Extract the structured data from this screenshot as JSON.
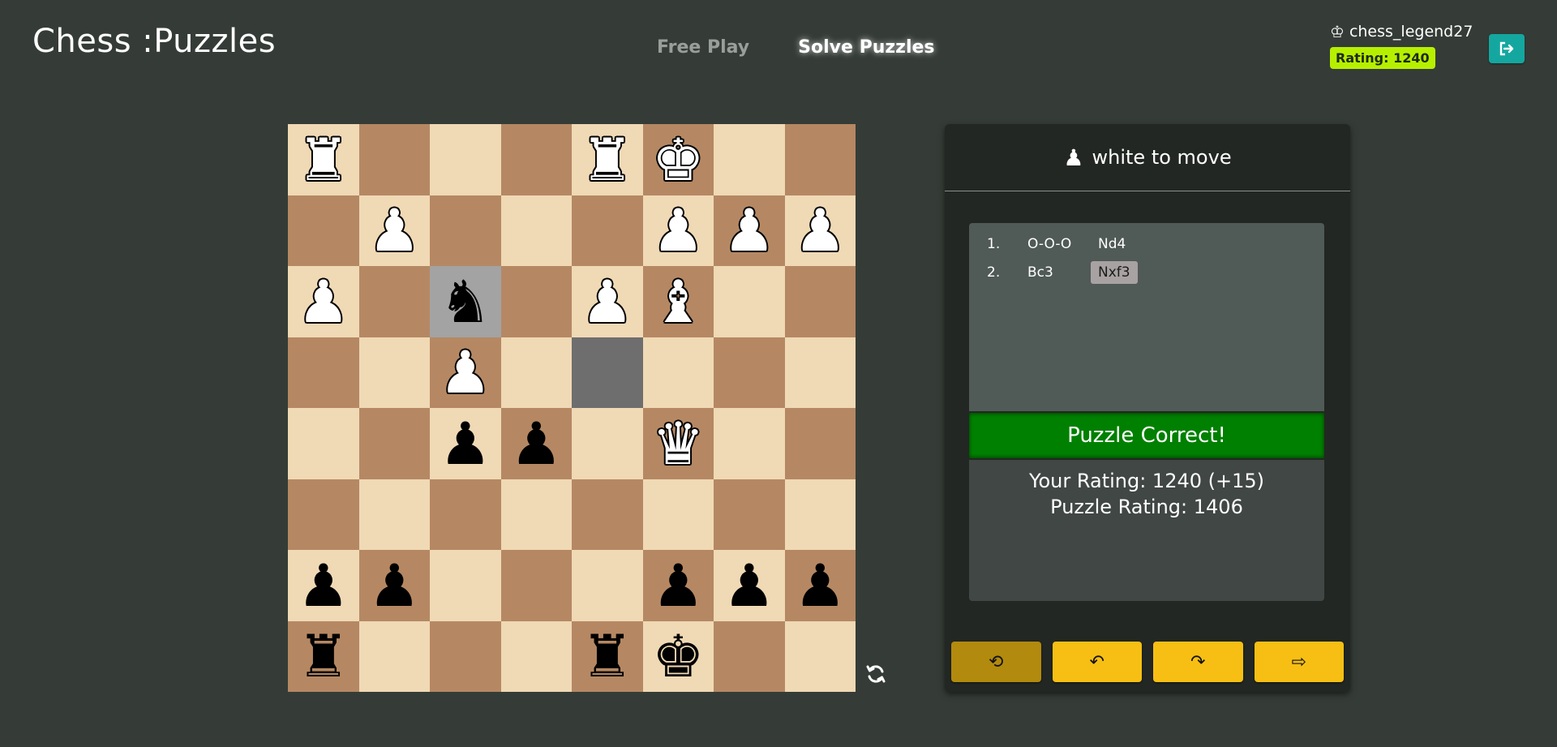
{
  "header": {
    "logo": "Chess :Puzzles",
    "nav": {
      "free_play": "Free Play",
      "solve_puzzles": "Solve Puzzles"
    },
    "user": {
      "icon": "crown-icon",
      "username": "chess_legend27",
      "rating_badge": "Rating: 1240"
    },
    "logout_icon": "logout-icon"
  },
  "board": {
    "ranks": [
      [
        "wR",
        "",
        "",
        "",
        "wR",
        "wK",
        "",
        ""
      ],
      [
        "",
        "wP",
        "",
        "",
        "",
        "wP",
        "wP",
        "wP"
      ],
      [
        "wP",
        "",
        "bN",
        "",
        "wP",
        "wB",
        "",
        ""
      ],
      [
        "",
        "",
        "wP",
        "",
        "",
        "",
        "",
        ""
      ],
      [
        "",
        "",
        "bP",
        "bP",
        "",
        "wQ",
        "",
        ""
      ],
      [
        "",
        "",
        "",
        "",
        "",
        "",
        "",
        ""
      ],
      [
        "bP",
        "bP",
        "",
        "",
        "",
        "bP",
        "bP",
        "bP"
      ],
      [
        "bR",
        "",
        "",
        "",
        "bR",
        "bK",
        "",
        ""
      ]
    ],
    "highlighted_squares": [
      [
        2,
        2
      ],
      [
        3,
        4
      ]
    ],
    "flip_icon": "flip-board-icon"
  },
  "panel": {
    "turn_text": "white to move",
    "moves": [
      {
        "num": "1.",
        "white": "O-O-O",
        "black": "Nd4"
      },
      {
        "num": "2.",
        "white": "Bc3",
        "black": "Nxf3"
      }
    ],
    "result": "Puzzle Correct!",
    "your_rating": "Your Rating: 1240 (+15)",
    "puzzle_rating": "Puzzle Rating: 1406",
    "controls": {
      "restart": "⟲",
      "undo": "↶",
      "redo": "↷",
      "next": "⇨"
    }
  }
}
